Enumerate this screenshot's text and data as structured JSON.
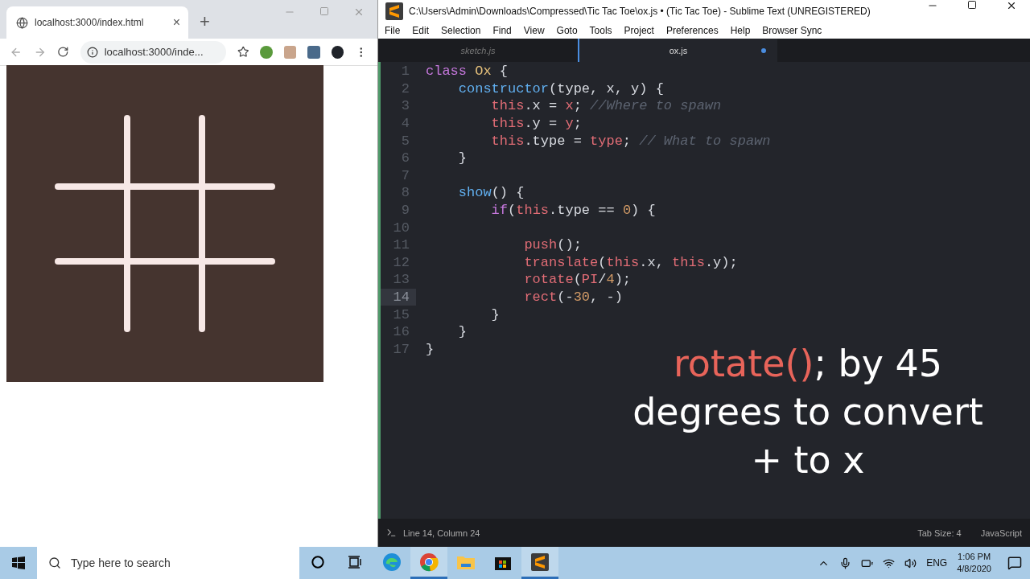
{
  "browser": {
    "tab_title": "localhost:3000/index.html",
    "tab_close": "×",
    "new_tab": "+",
    "address": "localhost:3000/inde...",
    "canvas": {
      "kind": "tic-tac-toe-grid"
    }
  },
  "editor": {
    "title": "C:\\Users\\Admin\\Downloads\\Compressed\\Tic Tac Toe\\ox.js • (Tic Tac Toe) - Sublime Text (UNREGISTERED)",
    "menu": [
      "File",
      "Edit",
      "Selection",
      "Find",
      "View",
      "Goto",
      "Tools",
      "Project",
      "Preferences",
      "Help",
      "Browser Sync"
    ],
    "tabs": [
      {
        "label": "sketch.js",
        "selected": false,
        "modified": false
      },
      {
        "label": "ox.js",
        "selected": true,
        "modified": true
      }
    ],
    "lines": [
      {
        "number": "1",
        "current": false,
        "tokens": [
          {
            "t": "class ",
            "kind": "kw"
          },
          {
            "t": "Ox",
            "kind": "cls"
          },
          {
            "t": " {",
            "kind": "p"
          }
        ]
      },
      {
        "number": "2",
        "current": false,
        "tokens": [
          {
            "t": "    constructor",
            "kind": "fn"
          },
          {
            "t": "(type, x, y) {",
            "kind": "p"
          }
        ]
      },
      {
        "number": "3",
        "current": false,
        "tokens": [
          {
            "t": "        this",
            "kind": "this"
          },
          {
            "t": ".x = ",
            "kind": "p"
          },
          {
            "t": "x",
            "kind": "var"
          },
          {
            "t": "; ",
            "kind": "p"
          },
          {
            "t": "//Where to spawn",
            "kind": "cm"
          }
        ]
      },
      {
        "number": "4",
        "current": false,
        "tokens": [
          {
            "t": "        this",
            "kind": "this"
          },
          {
            "t": ".y = ",
            "kind": "p"
          },
          {
            "t": "y",
            "kind": "var"
          },
          {
            "t": ";",
            "kind": "p"
          }
        ]
      },
      {
        "number": "5",
        "current": false,
        "tokens": [
          {
            "t": "        this",
            "kind": "this"
          },
          {
            "t": ".type = ",
            "kind": "p"
          },
          {
            "t": "type",
            "kind": "var"
          },
          {
            "t": "; ",
            "kind": "p"
          },
          {
            "t": "// What to spawn",
            "kind": "cm"
          }
        ]
      },
      {
        "number": "6",
        "current": false,
        "tokens": [
          {
            "t": "    }",
            "kind": "p"
          }
        ]
      },
      {
        "number": "7",
        "current": false
      },
      {
        "number": "8",
        "current": false,
        "tokens": [
          {
            "t": "    show",
            "kind": "fn"
          },
          {
            "t": "() {",
            "kind": "p"
          }
        ]
      },
      {
        "number": "9",
        "current": false,
        "tokens": [
          {
            "t": "        if",
            "kind": "kw"
          },
          {
            "t": "(",
            "kind": "p"
          },
          {
            "t": "this",
            "kind": "this"
          },
          {
            "t": ".type == ",
            "kind": "p"
          },
          {
            "t": "0",
            "kind": "num"
          },
          {
            "t": ") {",
            "kind": "p"
          }
        ]
      },
      {
        "number": "10",
        "current": false
      },
      {
        "number": "11",
        "current": false,
        "tokens": [
          {
            "t": "            push",
            "kind": "call"
          },
          {
            "t": "();",
            "kind": "p"
          }
        ]
      },
      {
        "number": "12",
        "current": false,
        "tokens": [
          {
            "t": "            translate",
            "kind": "call"
          },
          {
            "t": "(",
            "kind": "p"
          },
          {
            "t": "this",
            "kind": "this"
          },
          {
            "t": ".x, ",
            "kind": "p"
          },
          {
            "t": "this",
            "kind": "this"
          },
          {
            "t": ".y);",
            "kind": "p"
          }
        ]
      },
      {
        "number": "13",
        "current": false,
        "tokens": [
          {
            "t": "            rotate",
            "kind": "call"
          },
          {
            "t": "(",
            "kind": "p"
          },
          {
            "t": "PI",
            "kind": "var"
          },
          {
            "t": "/",
            "kind": "p"
          },
          {
            "t": "4",
            "kind": "num"
          },
          {
            "t": ");",
            "kind": "p"
          }
        ]
      },
      {
        "number": "14",
        "current": true,
        "tokens": [
          {
            "t": "            rect",
            "kind": "call"
          },
          {
            "t": "(-",
            "kind": "p"
          },
          {
            "t": "30",
            "kind": "num"
          },
          {
            "t": ", -)",
            "kind": "p"
          }
        ]
      },
      {
        "number": "15",
        "current": false,
        "tokens": [
          {
            "t": "        }",
            "kind": "p"
          }
        ]
      },
      {
        "number": "16",
        "current": false,
        "tokens": [
          {
            "t": "    }",
            "kind": "p"
          }
        ]
      },
      {
        "number": "17",
        "current": false,
        "tokens": [
          {
            "t": "}",
            "kind": "p"
          }
        ]
      }
    ],
    "caption": {
      "highlight": "rotate()",
      "rest": "; by 45",
      "lines": [
        "degrees to convert",
        "+ to x"
      ]
    },
    "status": {
      "position": "Line 14, Column 24",
      "tab_size": "Tab Size: 4",
      "syntax": "JavaScript"
    }
  },
  "taskbar": {
    "search_placeholder": "Type here to search",
    "apps": [
      {
        "kind": "edge",
        "selected": false
      },
      {
        "kind": "chrome",
        "selected": true
      },
      {
        "kind": "explorer",
        "selected": false
      },
      {
        "kind": "store",
        "selected": false
      },
      {
        "kind": "sublime",
        "selected": true
      }
    ],
    "language": "ENG",
    "time": "1:06 PM",
    "date": "4/8/2020"
  }
}
